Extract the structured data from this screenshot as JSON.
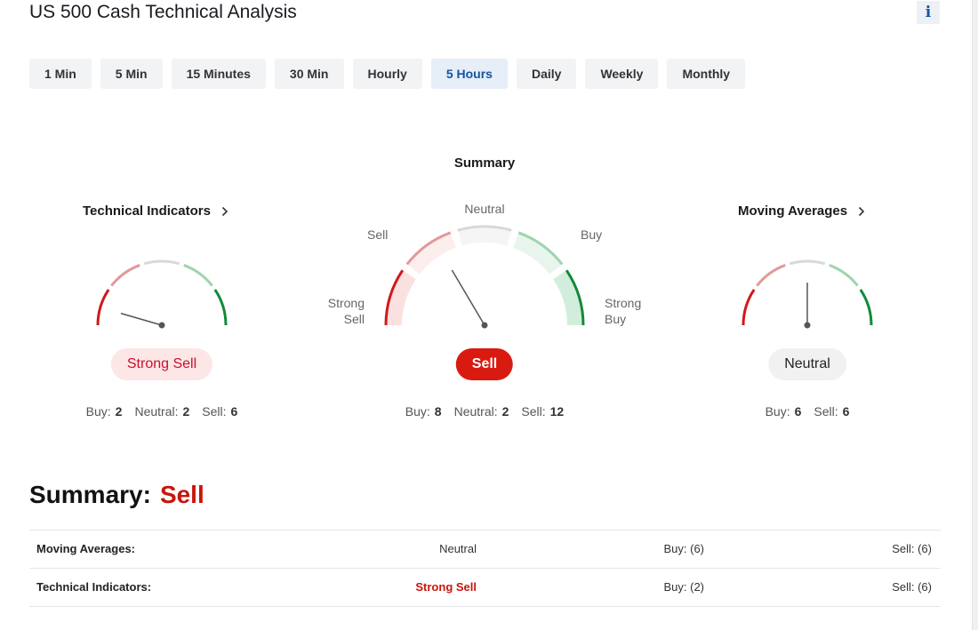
{
  "page_title": "US 500 Cash Technical Analysis",
  "info_icon": "i",
  "timeframes": {
    "items": [
      "1 Min",
      "5 Min",
      "15 Minutes",
      "30 Min",
      "Hourly",
      "5 Hours",
      "Daily",
      "Weekly",
      "Monthly"
    ],
    "active": "5 Hours"
  },
  "summary_gauge": {
    "heading": "Summary",
    "labels": {
      "strong_sell": [
        "Strong",
        "Sell"
      ],
      "sell": "Sell",
      "neutral": "Neutral",
      "buy": "Buy",
      "strong_buy": [
        "Strong",
        "Buy"
      ]
    },
    "signal": "Sell",
    "needle_position": 0.33,
    "counts": {
      "buy_label": "Buy:",
      "buy": "8",
      "neutral_label": "Neutral:",
      "neutral": "2",
      "sell_label": "Sell:",
      "sell": "12"
    }
  },
  "technical_indicators": {
    "title": "Technical Indicators",
    "signal": "Strong Sell",
    "needle_position": 0.09,
    "counts": {
      "buy_label": "Buy:",
      "buy": "2",
      "neutral_label": "Neutral:",
      "neutral": "2",
      "sell_label": "Sell:",
      "sell": "6"
    }
  },
  "moving_averages": {
    "title": "Moving Averages",
    "signal": "Neutral",
    "needle_position": 0.5,
    "counts": {
      "buy_label": "Buy:",
      "buy": "6",
      "sell_label": "Sell:",
      "sell": "6"
    }
  },
  "bottom_summary": {
    "label": "Summary:",
    "value": "Sell"
  },
  "table": [
    {
      "name": "Moving Averages:",
      "signal": "Neutral",
      "buy": "Buy: (6)",
      "sell": "Sell: (6)"
    },
    {
      "name": "Technical Indicators:",
      "signal": "Strong Sell",
      "buy": "Buy: (2)",
      "sell": "Sell: (6)"
    }
  ],
  "colors": {
    "strong_sell": "#d0181c",
    "sell": "#e09a9a",
    "neutral": "#d8d8d8",
    "buy": "#9fd4b0",
    "strong_buy": "#108a3a",
    "accent": "#1256a0"
  }
}
